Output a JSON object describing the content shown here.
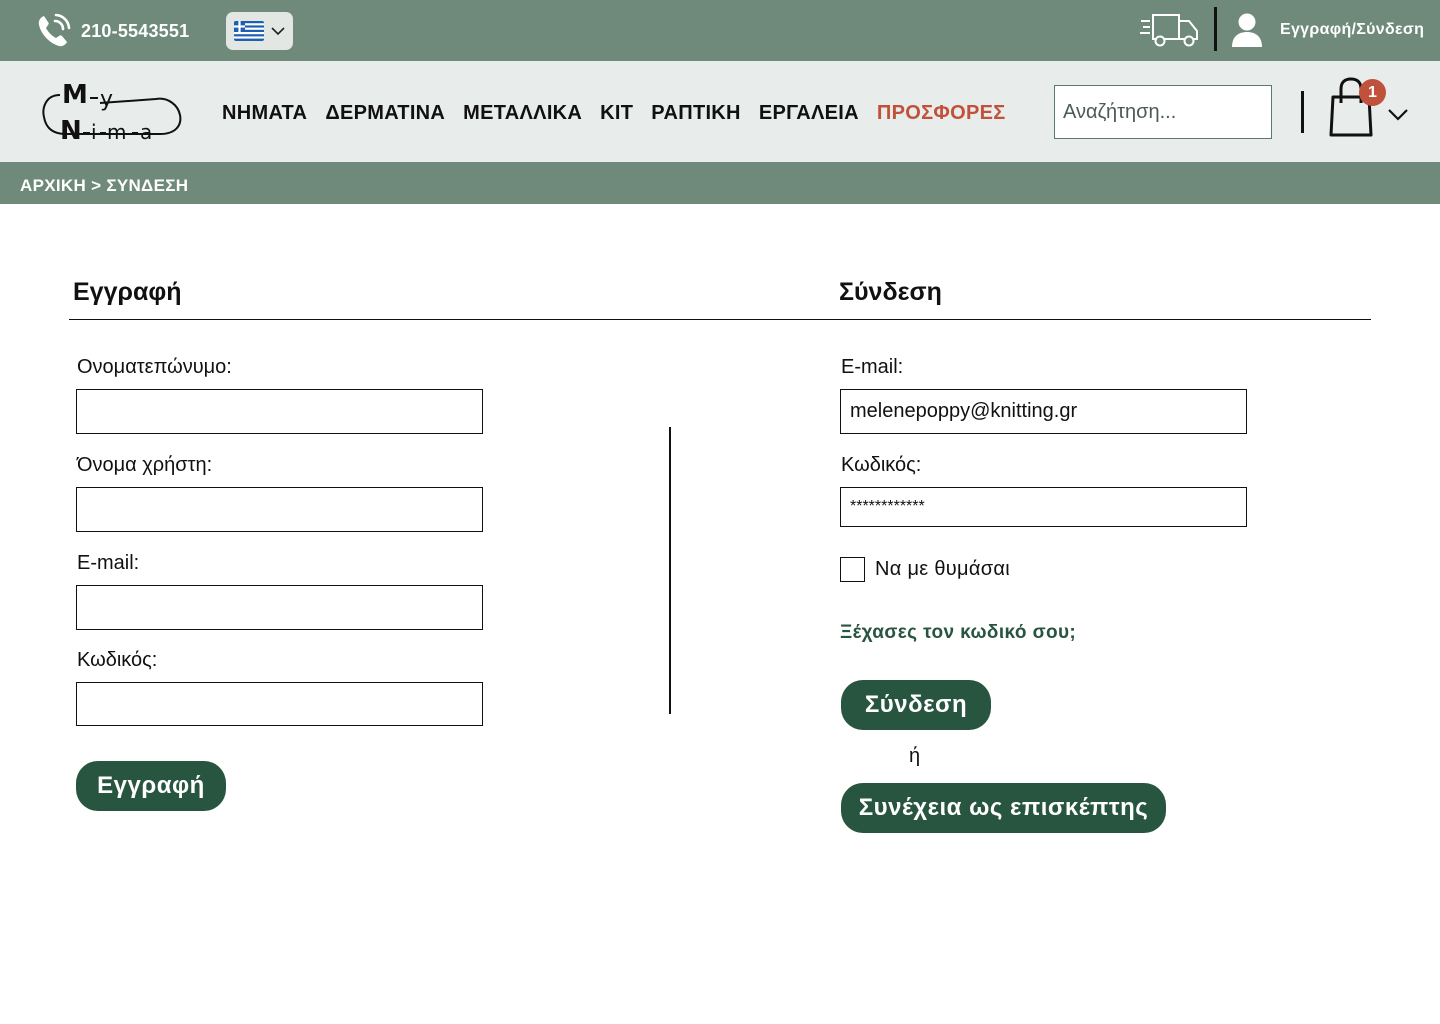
{
  "topbar": {
    "phone": "210-5543551",
    "language": "Ελληνικά",
    "auth_link": "Εγγραφή/Σύνδεση"
  },
  "header": {
    "logo_text": "My Nima",
    "nav": [
      "ΝΗΜΑΤΑ",
      "ΔΕΡΜΑΤΙΝΑ",
      "ΜΕΤΑΛΛΙΚΑ",
      "ΚΙΤ",
      "ΡΑΠΤΙΚΗ",
      "ΕΡΓΑΛΕΙΑ",
      "ΠΡΟΣΦΟΡΕΣ"
    ],
    "search_placeholder": "Αναζήτηση...",
    "cart_count": "1"
  },
  "breadcrumb": {
    "home": "ΑΡΧΙΚΗ",
    "separator": " > ",
    "current": "ΣΥΝΔΕΣΗ"
  },
  "register": {
    "title": "Εγγραφή",
    "fullname_label": "Ονοματεπώνυμο:",
    "fullname_value": "",
    "username_label": "Όνομα χρήστη:",
    "username_value": "",
    "email_label": "E-mail:",
    "email_value": "",
    "password_label": "Κωδικός:",
    "password_value": "",
    "submit_label": "Εγγραφή"
  },
  "login": {
    "title": "Σύνδεση",
    "email_label": "E-mail:",
    "email_value": "melenepoppy@knitting.gr",
    "password_label": "Κωδικός:",
    "password_value": "************",
    "remember_label": "Να με θυμάσαι",
    "remember_checked": false,
    "forgot_label": "Ξέχασες τον κωδικό σου;",
    "submit_label": "Σύνδεση",
    "or_label": "ή",
    "guest_label": "Συνέχεια ως επισκέπτης"
  },
  "colors": {
    "topbar": "#6f8a7b",
    "header_bg": "#e8ecea",
    "accent_green": "#285540",
    "offers_red": "#c0513b"
  }
}
